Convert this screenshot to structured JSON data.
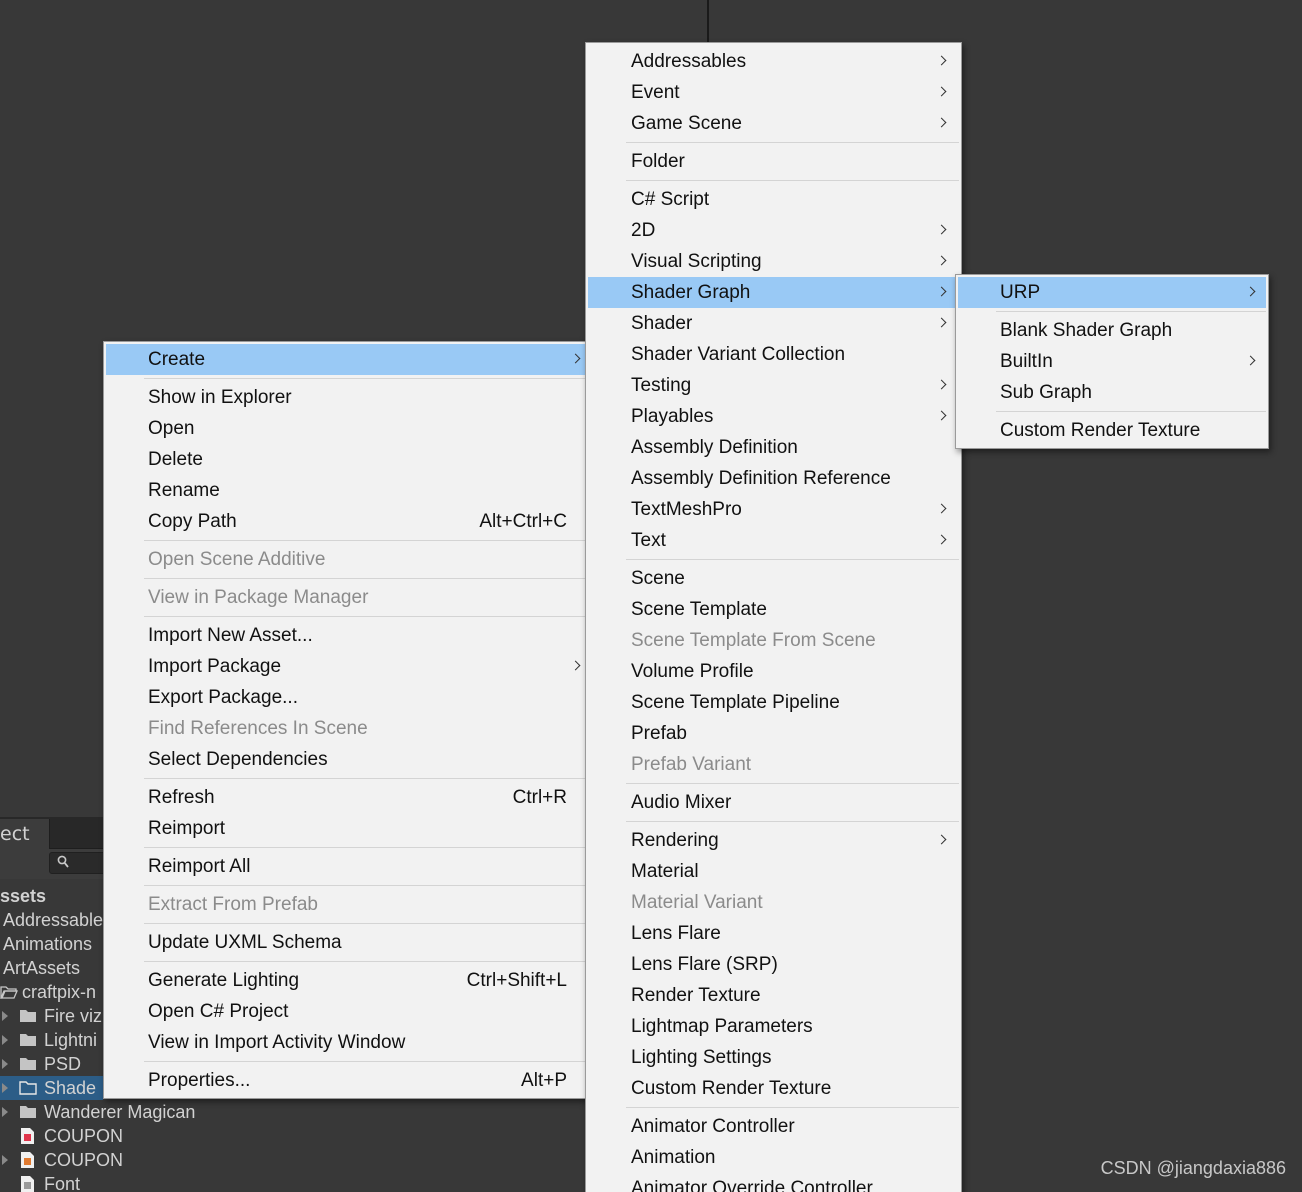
{
  "project_panel": {
    "tab_label": "ect",
    "assets_header": "ssets",
    "tree": [
      {
        "label": "Addressable",
        "kind": "plain"
      },
      {
        "label": "Animations",
        "kind": "plain"
      },
      {
        "label": "ArtAssets",
        "kind": "plain"
      },
      {
        "label": "craftpix-n",
        "kind": "open-folder"
      },
      {
        "label": "Fire viz",
        "kind": "folder"
      },
      {
        "label": "Lightni",
        "kind": "folder"
      },
      {
        "label": "PSD",
        "kind": "folder"
      },
      {
        "label": "Shade",
        "kind": "folder-selected"
      },
      {
        "label": "Wanderer Magican",
        "kind": "folder"
      },
      {
        "label": "COUPON",
        "kind": "file-red"
      },
      {
        "label": "COUPON",
        "kind": "file-img"
      },
      {
        "label": "Font",
        "kind": "file-doc"
      }
    ]
  },
  "main_menu": {
    "items": [
      {
        "label": "Create",
        "submenu": true,
        "highlight": true
      },
      {
        "sep": true
      },
      {
        "label": "Show in Explorer"
      },
      {
        "label": "Open"
      },
      {
        "label": "Delete"
      },
      {
        "label": "Rename"
      },
      {
        "label": "Copy Path",
        "shortcut": "Alt+Ctrl+C"
      },
      {
        "sep": true
      },
      {
        "label": "Open Scene Additive",
        "disabled": true
      },
      {
        "sep": true
      },
      {
        "label": "View in Package Manager",
        "disabled": true
      },
      {
        "sep": true
      },
      {
        "label": "Import New Asset..."
      },
      {
        "label": "Import Package",
        "submenu": true
      },
      {
        "label": "Export Package..."
      },
      {
        "label": "Find References In Scene",
        "disabled": true
      },
      {
        "label": "Select Dependencies"
      },
      {
        "sep": true
      },
      {
        "label": "Refresh",
        "shortcut": "Ctrl+R"
      },
      {
        "label": "Reimport"
      },
      {
        "sep": true
      },
      {
        "label": "Reimport All"
      },
      {
        "sep": true
      },
      {
        "label": "Extract From Prefab",
        "disabled": true
      },
      {
        "sep": true
      },
      {
        "label": "Update UXML Schema"
      },
      {
        "sep": true
      },
      {
        "label": "Generate Lighting",
        "shortcut": "Ctrl+Shift+L"
      },
      {
        "label": "Open C# Project"
      },
      {
        "label": "View in Import Activity Window"
      },
      {
        "sep": true
      },
      {
        "label": "Properties...",
        "shortcut": "Alt+P"
      }
    ]
  },
  "create_menu": {
    "items": [
      {
        "label": "Addressables",
        "submenu": true
      },
      {
        "label": "Event",
        "submenu": true
      },
      {
        "label": "Game Scene",
        "submenu": true
      },
      {
        "sep": true
      },
      {
        "label": "Folder"
      },
      {
        "sep": true
      },
      {
        "label": "C# Script"
      },
      {
        "label": "2D",
        "submenu": true
      },
      {
        "label": "Visual Scripting",
        "submenu": true
      },
      {
        "label": "Shader Graph",
        "submenu": true,
        "highlight": true
      },
      {
        "label": "Shader",
        "submenu": true
      },
      {
        "label": "Shader Variant Collection"
      },
      {
        "label": "Testing",
        "submenu": true
      },
      {
        "label": "Playables",
        "submenu": true
      },
      {
        "label": "Assembly Definition"
      },
      {
        "label": "Assembly Definition Reference"
      },
      {
        "label": "TextMeshPro",
        "submenu": true
      },
      {
        "label": "Text",
        "submenu": true
      },
      {
        "sep": true
      },
      {
        "label": "Scene"
      },
      {
        "label": "Scene Template"
      },
      {
        "label": "Scene Template From Scene",
        "disabled": true
      },
      {
        "label": "Volume Profile"
      },
      {
        "label": "Scene Template Pipeline"
      },
      {
        "label": "Prefab"
      },
      {
        "label": "Prefab Variant",
        "disabled": true
      },
      {
        "sep": true
      },
      {
        "label": "Audio Mixer"
      },
      {
        "sep": true
      },
      {
        "label": "Rendering",
        "submenu": true
      },
      {
        "label": "Material"
      },
      {
        "label": "Material Variant",
        "disabled": true
      },
      {
        "label": "Lens Flare"
      },
      {
        "label": "Lens Flare (SRP)"
      },
      {
        "label": "Render Texture"
      },
      {
        "label": "Lightmap Parameters"
      },
      {
        "label": "Lighting Settings"
      },
      {
        "label": "Custom Render Texture"
      },
      {
        "sep": true
      },
      {
        "label": "Animator Controller"
      },
      {
        "label": "Animation"
      },
      {
        "label": "Animator Override Controller"
      }
    ]
  },
  "shader_graph_menu": {
    "items": [
      {
        "label": "URP",
        "submenu": true,
        "highlight": true
      },
      {
        "sep": true
      },
      {
        "label": "Blank Shader Graph"
      },
      {
        "label": "BuiltIn",
        "submenu": true
      },
      {
        "label": "Sub Graph"
      },
      {
        "sep": true
      },
      {
        "label": "Custom Render Texture"
      }
    ]
  },
  "watermark": "CSDN @jiangdaxia886",
  "colors": {
    "editor_bg": "#383838",
    "menu_bg": "#f2f2f2",
    "menu_highlight": "#99c9f5",
    "menu_disabled_text": "#8b8b8b",
    "tree_selected": "#2c5d87"
  }
}
